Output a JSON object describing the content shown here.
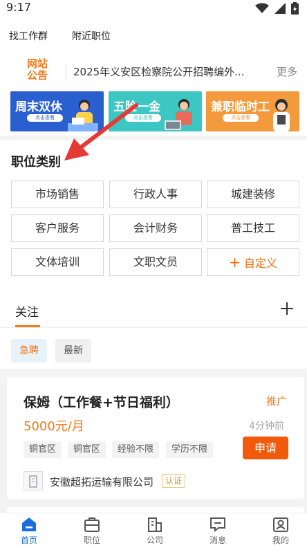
{
  "status_bar": {
    "time": "9:17"
  },
  "top_nav": {
    "items": [
      "找工作群",
      "附近职位"
    ]
  },
  "notice": {
    "logo_line1": "网站",
    "logo_line2": "公告",
    "text": "2025年义安区检察院公开招聘编外...",
    "more": "更多"
  },
  "banners": [
    {
      "title": "周末双休",
      "pill": "点击查看",
      "bg": "#2a5fd0",
      "title_color": "#ffffff"
    },
    {
      "title": "五险一金",
      "pill": "点击查看",
      "bg": "#3cc7c2",
      "title_color": "#ffffff"
    },
    {
      "title": "兼职临时工",
      "pill": "点击查看",
      "bg": "#f39a3c",
      "title_color": "#ffffff"
    }
  ],
  "category": {
    "title": "职位类别",
    "items": [
      "市场销售",
      "行政人事",
      "城建装修",
      "客户服务",
      "会计财务",
      "普工技工",
      "文体培训",
      "文职文员"
    ],
    "custom": "自定义",
    "custom_plus": "+"
  },
  "tabs": {
    "follow": "关注"
  },
  "filters": {
    "urgent": "急聘",
    "latest": "最新"
  },
  "job": {
    "title": "保姆（工作餐+节日福利）",
    "badge": "推广",
    "salary": "5000元/月",
    "time": "4分钟前",
    "tags": [
      "铜官区",
      "铜官区",
      "经验不限",
      "学历不限"
    ],
    "apply": "申请",
    "company": "安徽超拓运输有限公司",
    "verified": "认证"
  },
  "bottom_nav": {
    "items": [
      {
        "label": "首页",
        "icon": "home-icon",
        "active": true
      },
      {
        "label": "职位",
        "icon": "briefcase-icon",
        "active": false
      },
      {
        "label": "公司",
        "icon": "building-icon",
        "active": false
      },
      {
        "label": "消息",
        "icon": "message-icon",
        "active": false
      },
      {
        "label": "我的",
        "icon": "profile-icon",
        "active": false
      }
    ]
  },
  "colors": {
    "accent": "#f07a1e",
    "primary": "#1a6fe0",
    "apply": "#f05a0a"
  }
}
